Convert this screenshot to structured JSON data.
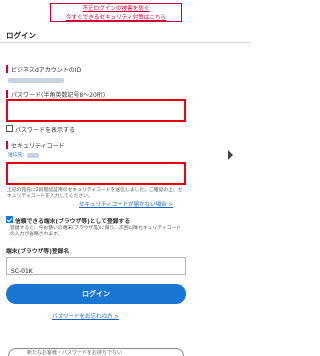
{
  "banner": {
    "line1": "不正ログインの被害を防ぐ",
    "line2": "今すぐできるセキュリティ対策はこちら"
  },
  "header": {
    "title": "ログイン"
  },
  "labels": {
    "business_id": "ビジネスdアカウントのID",
    "password": "パスワード(半角英数記号8〜20桁)",
    "show_password": "パスワードを表示する",
    "security_code": "セキュリティコード",
    "sent_to": "送信先："
  },
  "messages": {
    "security_note": "上記の宛先に2段階認証用のセキュリティコードを送信しました。ご確認の上、セキュリティコードを入力してください。",
    "code_missing": "セキュリティコードが届かない場合 >",
    "trusted_device": "信頼できる端末(ブラウザ等)として登録する",
    "trusted_note": "登録すると、今お使いの端末(ブラウザ等)に限り、次回以降セキュリティコードの入力が省略されます。",
    "device_name_label": "端末(ブラウザ等)登録名",
    "device_name_value": "SC-01K",
    "login_button": "ログイン",
    "forgot_password": "パスワードをお忘れの方 >",
    "bottom_text": "新たなお客様・パスワードをお持ちでない"
  }
}
